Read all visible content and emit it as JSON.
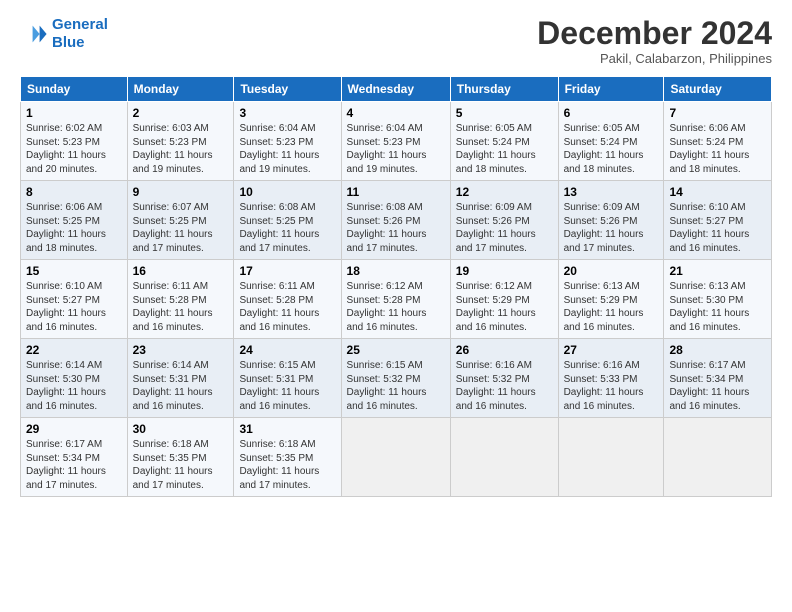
{
  "logo": {
    "line1": "General",
    "line2": "Blue"
  },
  "title": "December 2024",
  "subtitle": "Pakil, Calabarzon, Philippines",
  "days_of_week": [
    "Sunday",
    "Monday",
    "Tuesday",
    "Wednesday",
    "Thursday",
    "Friday",
    "Saturday"
  ],
  "weeks": [
    [
      {
        "day": "1",
        "detail": "Sunrise: 6:02 AM\nSunset: 5:23 PM\nDaylight: 11 hours\nand 20 minutes."
      },
      {
        "day": "2",
        "detail": "Sunrise: 6:03 AM\nSunset: 5:23 PM\nDaylight: 11 hours\nand 19 minutes."
      },
      {
        "day": "3",
        "detail": "Sunrise: 6:04 AM\nSunset: 5:23 PM\nDaylight: 11 hours\nand 19 minutes."
      },
      {
        "day": "4",
        "detail": "Sunrise: 6:04 AM\nSunset: 5:23 PM\nDaylight: 11 hours\nand 19 minutes."
      },
      {
        "day": "5",
        "detail": "Sunrise: 6:05 AM\nSunset: 5:24 PM\nDaylight: 11 hours\nand 18 minutes."
      },
      {
        "day": "6",
        "detail": "Sunrise: 6:05 AM\nSunset: 5:24 PM\nDaylight: 11 hours\nand 18 minutes."
      },
      {
        "day": "7",
        "detail": "Sunrise: 6:06 AM\nSunset: 5:24 PM\nDaylight: 11 hours\nand 18 minutes."
      }
    ],
    [
      {
        "day": "8",
        "detail": "Sunrise: 6:06 AM\nSunset: 5:25 PM\nDaylight: 11 hours\nand 18 minutes."
      },
      {
        "day": "9",
        "detail": "Sunrise: 6:07 AM\nSunset: 5:25 PM\nDaylight: 11 hours\nand 17 minutes."
      },
      {
        "day": "10",
        "detail": "Sunrise: 6:08 AM\nSunset: 5:25 PM\nDaylight: 11 hours\nand 17 minutes."
      },
      {
        "day": "11",
        "detail": "Sunrise: 6:08 AM\nSunset: 5:26 PM\nDaylight: 11 hours\nand 17 minutes."
      },
      {
        "day": "12",
        "detail": "Sunrise: 6:09 AM\nSunset: 5:26 PM\nDaylight: 11 hours\nand 17 minutes."
      },
      {
        "day": "13",
        "detail": "Sunrise: 6:09 AM\nSunset: 5:26 PM\nDaylight: 11 hours\nand 17 minutes."
      },
      {
        "day": "14",
        "detail": "Sunrise: 6:10 AM\nSunset: 5:27 PM\nDaylight: 11 hours\nand 16 minutes."
      }
    ],
    [
      {
        "day": "15",
        "detail": "Sunrise: 6:10 AM\nSunset: 5:27 PM\nDaylight: 11 hours\nand 16 minutes."
      },
      {
        "day": "16",
        "detail": "Sunrise: 6:11 AM\nSunset: 5:28 PM\nDaylight: 11 hours\nand 16 minutes."
      },
      {
        "day": "17",
        "detail": "Sunrise: 6:11 AM\nSunset: 5:28 PM\nDaylight: 11 hours\nand 16 minutes."
      },
      {
        "day": "18",
        "detail": "Sunrise: 6:12 AM\nSunset: 5:28 PM\nDaylight: 11 hours\nand 16 minutes."
      },
      {
        "day": "19",
        "detail": "Sunrise: 6:12 AM\nSunset: 5:29 PM\nDaylight: 11 hours\nand 16 minutes."
      },
      {
        "day": "20",
        "detail": "Sunrise: 6:13 AM\nSunset: 5:29 PM\nDaylight: 11 hours\nand 16 minutes."
      },
      {
        "day": "21",
        "detail": "Sunrise: 6:13 AM\nSunset: 5:30 PM\nDaylight: 11 hours\nand 16 minutes."
      }
    ],
    [
      {
        "day": "22",
        "detail": "Sunrise: 6:14 AM\nSunset: 5:30 PM\nDaylight: 11 hours\nand 16 minutes."
      },
      {
        "day": "23",
        "detail": "Sunrise: 6:14 AM\nSunset: 5:31 PM\nDaylight: 11 hours\nand 16 minutes."
      },
      {
        "day": "24",
        "detail": "Sunrise: 6:15 AM\nSunset: 5:31 PM\nDaylight: 11 hours\nand 16 minutes."
      },
      {
        "day": "25",
        "detail": "Sunrise: 6:15 AM\nSunset: 5:32 PM\nDaylight: 11 hours\nand 16 minutes."
      },
      {
        "day": "26",
        "detail": "Sunrise: 6:16 AM\nSunset: 5:32 PM\nDaylight: 11 hours\nand 16 minutes."
      },
      {
        "day": "27",
        "detail": "Sunrise: 6:16 AM\nSunset: 5:33 PM\nDaylight: 11 hours\nand 16 minutes."
      },
      {
        "day": "28",
        "detail": "Sunrise: 6:17 AM\nSunset: 5:34 PM\nDaylight: 11 hours\nand 16 minutes."
      }
    ],
    [
      {
        "day": "29",
        "detail": "Sunrise: 6:17 AM\nSunset: 5:34 PM\nDaylight: 11 hours\nand 17 minutes."
      },
      {
        "day": "30",
        "detail": "Sunrise: 6:18 AM\nSunset: 5:35 PM\nDaylight: 11 hours\nand 17 minutes."
      },
      {
        "day": "31",
        "detail": "Sunrise: 6:18 AM\nSunset: 5:35 PM\nDaylight: 11 hours\nand 17 minutes."
      },
      null,
      null,
      null,
      null
    ]
  ]
}
